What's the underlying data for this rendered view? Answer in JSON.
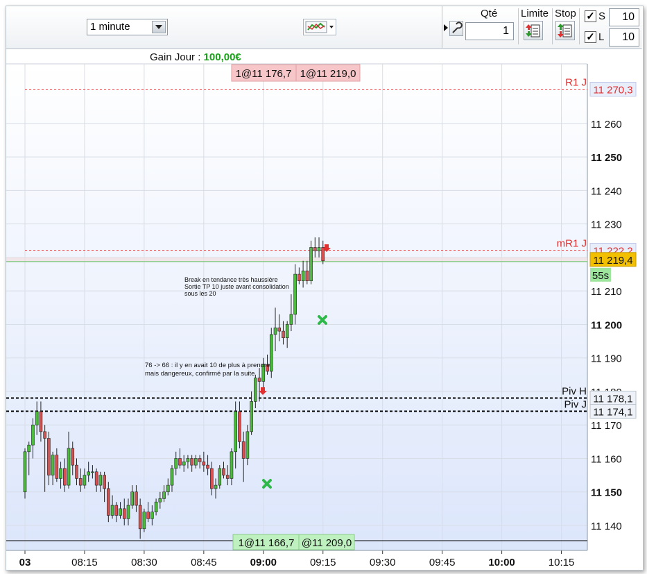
{
  "toolbar": {
    "timeframe": "1 minute",
    "qty_label": "Qté",
    "qty_value": "1",
    "limit_label": "Limite",
    "stop_label": "Stop",
    "s_label": "S",
    "s_value": "10",
    "l_label": "L",
    "l_value": "10"
  },
  "gain": {
    "label": "Gain Jour : ",
    "value": "100,00€"
  },
  "orders": {
    "top_left": "1@11 176,7",
    "top_right": "1@11 219,0",
    "bottom_left": "1@11 166,7",
    "bottom_right": "@11 209,0"
  },
  "levels": [
    {
      "name": "R1 J",
      "value": 11270.3,
      "label": "11 270,3",
      "color": "#e03030",
      "style": "dashed-red"
    },
    {
      "name": "mR1 J",
      "value": 11222.2,
      "label": "11 222,2",
      "color": "#e03030",
      "style": "dashed-red"
    },
    {
      "name": "Piv H",
      "value": 11178.1,
      "label": "11 178,1",
      "color": "#000000",
      "style": "dashed-black"
    },
    {
      "name": "Piv J",
      "value": 11174.1,
      "label": "11 174,1",
      "color": "#000000",
      "style": "dashed-black"
    }
  ],
  "current_price": {
    "value": 11219.4,
    "label": "11 219,4",
    "countdown": "55s"
  },
  "annotations": [
    {
      "lines": [
        "Break en tendance très haussière",
        "Sortie TP 10 juste avant consolidation",
        "sous les 20"
      ]
    },
    {
      "lines": [
        "76 -> 66 : il y en avait 10 de plus à prendre",
        "mais dangereux, confirmé par la suite"
      ]
    }
  ],
  "chart_data": {
    "type": "candlestick",
    "ylim": [
      11135,
      11280
    ],
    "yticks": [
      {
        "value": 11140,
        "label": "11 140",
        "bold": false
      },
      {
        "value": 11150,
        "label": "11 150",
        "bold": true
      },
      {
        "value": 11160,
        "label": "11 160",
        "bold": false
      },
      {
        "value": 11170,
        "label": "11 170",
        "bold": false
      },
      {
        "value": 11180,
        "label": "11 180",
        "bold": false
      },
      {
        "value": 11190,
        "label": "11 190",
        "bold": false
      },
      {
        "value": 11200,
        "label": "11 200",
        "bold": true
      },
      {
        "value": 11210,
        "label": "11 210",
        "bold": false
      },
      {
        "value": 11220,
        "label": "11 220",
        "bold": false
      },
      {
        "value": 11230,
        "label": "11 230",
        "bold": false
      },
      {
        "value": 11240,
        "label": "11 240",
        "bold": false
      },
      {
        "value": 11250,
        "label": "11 250",
        "bold": true
      },
      {
        "value": 11260,
        "label": "11 260",
        "bold": false
      }
    ],
    "xticks": [
      {
        "t": 0,
        "label": "03",
        "bold": true
      },
      {
        "t": 15,
        "label": "08:15",
        "bold": false
      },
      {
        "t": 30,
        "label": "08:30",
        "bold": false
      },
      {
        "t": 45,
        "label": "08:45",
        "bold": false
      },
      {
        "t": 60,
        "label": "09:00",
        "bold": true
      },
      {
        "t": 75,
        "label": "09:15",
        "bold": false
      },
      {
        "t": 90,
        "label": "09:30",
        "bold": false
      },
      {
        "t": 105,
        "label": "09:45",
        "bold": false
      },
      {
        "t": 120,
        "label": "10:00",
        "bold": true
      },
      {
        "t": 135,
        "label": "10:15",
        "bold": false
      }
    ],
    "candles": [
      [
        11150,
        11163,
        11148,
        11162
      ],
      [
        11162,
        11165,
        11155,
        11164
      ],
      [
        11164,
        11172,
        11160,
        11170
      ],
      [
        11170,
        11177,
        11167,
        11174
      ],
      [
        11174,
        11177,
        11165,
        11168
      ],
      [
        11168,
        11170,
        11150,
        11166
      ],
      [
        11166,
        11168,
        11152,
        11155
      ],
      [
        11155,
        11162,
        11152,
        11161
      ],
      [
        11161,
        11163,
        11153,
        11154
      ],
      [
        11154,
        11159,
        11151,
        11157
      ],
      [
        11157,
        11160,
        11150,
        11152
      ],
      [
        11152,
        11168,
        11151,
        11163
      ],
      [
        11163,
        11165,
        11155,
        11158
      ],
      [
        11158,
        11160,
        11152,
        11154
      ],
      [
        11154,
        11157,
        11150,
        11152
      ],
      [
        11152,
        11157,
        11151,
        11155
      ],
      [
        11155,
        11159,
        11153,
        11156
      ],
      [
        11156,
        11158,
        11154,
        11156
      ],
      [
        11156,
        11157,
        11150,
        11152
      ],
      [
        11152,
        11156,
        11150,
        11155
      ],
      [
        11155,
        11156,
        11147,
        11151
      ],
      [
        11151,
        11153,
        11141,
        11143
      ],
      [
        11143,
        11149,
        11142,
        11146
      ],
      [
        11146,
        11147,
        11141,
        11143
      ],
      [
        11143,
        11147,
        11142,
        11145
      ],
      [
        11145,
        11148,
        11140,
        11142
      ],
      [
        11142,
        11148,
        11140,
        11146
      ],
      [
        11146,
        11152,
        11145,
        11150
      ],
      [
        11150,
        11152,
        11144,
        11146
      ],
      [
        11146,
        11148,
        11136,
        11139
      ],
      [
        11139,
        11145,
        11138,
        11144
      ],
      [
        11144,
        11147,
        11141,
        11142
      ],
      [
        11142,
        11146,
        11140,
        11144
      ],
      [
        11144,
        11148,
        11143,
        11147
      ],
      [
        11147,
        11150,
        11145,
        11148
      ],
      [
        11148,
        11152,
        11147,
        11150
      ],
      [
        11150,
        11154,
        11149,
        11152
      ],
      [
        11152,
        11158,
        11150,
        11157
      ],
      [
        11157,
        11162,
        11155,
        11160
      ],
      [
        11160,
        11163,
        11157,
        11158
      ],
      [
        11158,
        11161,
        11156,
        11159
      ],
      [
        11159,
        11161,
        11157,
        11160
      ],
      [
        11160,
        11161,
        11156,
        11158
      ],
      [
        11158,
        11161,
        11157,
        11160
      ],
      [
        11160,
        11161,
        11157,
        11159
      ],
      [
        11159,
        11162,
        11156,
        11158
      ],
      [
        11158,
        11161,
        11155,
        11157
      ],
      [
        11157,
        11159,
        11149,
        11151
      ],
      [
        11151,
        11154,
        11148,
        11152
      ],
      [
        11152,
        11158,
        11151,
        11157
      ],
      [
        11157,
        11159,
        11154,
        11155
      ],
      [
        11155,
        11158,
        11152,
        11154
      ],
      [
        11154,
        11163,
        11152,
        11162
      ],
      [
        11162,
        11177,
        11157,
        11174
      ],
      [
        11174,
        11177,
        11163,
        11165
      ],
      [
        11165,
        11168,
        11153,
        11160
      ],
      [
        11160,
        11170,
        11158,
        11168
      ],
      [
        11168,
        11180,
        11167,
        11177
      ],
      [
        11177,
        11185,
        11175,
        11184
      ],
      [
        11184,
        11187,
        11177,
        11183
      ],
      [
        11183,
        11190,
        11181,
        11188
      ],
      [
        11188,
        11191,
        11185,
        11186
      ],
      [
        11186,
        11199,
        11184,
        11197
      ],
      [
        11197,
        11205,
        11192,
        11199
      ],
      [
        11199,
        11203,
        11195,
        11198
      ],
      [
        11198,
        11201,
        11194,
        11196
      ],
      [
        11196,
        11201,
        11193,
        11200
      ],
      [
        11200,
        11209,
        11198,
        11203
      ],
      [
        11203,
        11218,
        11200,
        11215
      ],
      [
        11215,
        11217,
        11212,
        11213
      ],
      [
        11213,
        11219,
        11211,
        11216
      ],
      [
        11216,
        11219,
        11212,
        11213
      ],
      [
        11213,
        11225,
        11212,
        11223
      ],
      [
        11223,
        11226,
        11220,
        11222
      ],
      [
        11222,
        11226,
        11220,
        11223
      ],
      [
        11223,
        11225,
        11218,
        11219
      ]
    ]
  }
}
